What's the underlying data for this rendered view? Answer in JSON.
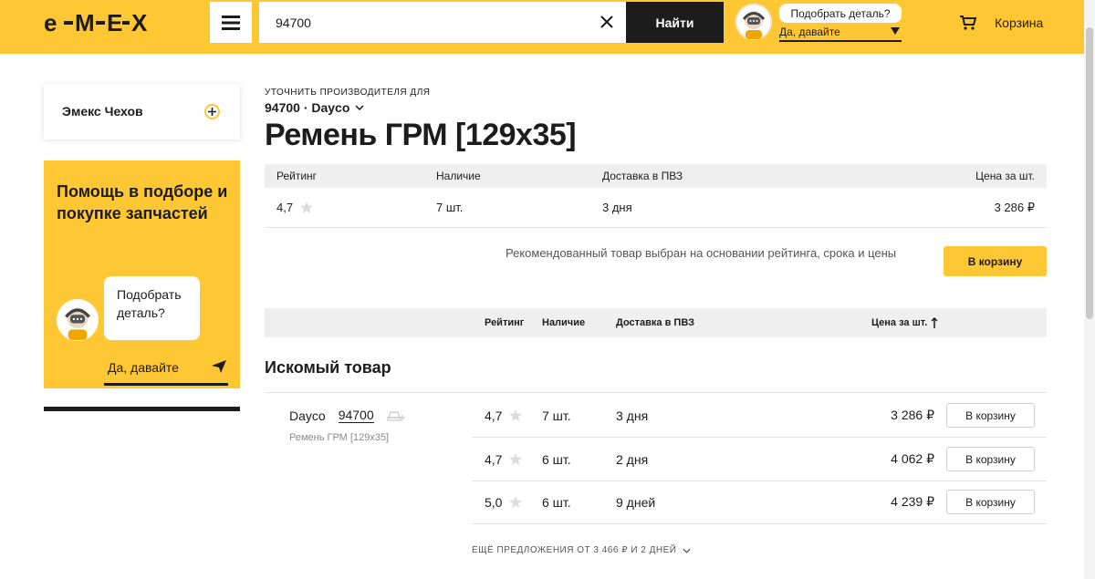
{
  "header": {
    "logo_text": "EMEX",
    "search_value": "94700",
    "search_button": "Найти",
    "bubble_text": "Подобрать деталь?",
    "bubble_link": "Да, давайте",
    "cart_label": "Корзина",
    "colors": {
      "brand_yellow": "#ffc733",
      "dark": "#1c1c1c"
    }
  },
  "sidebar": {
    "store_name": "Эмекс Чехов",
    "help_title": "Помощь в подборе и покупке запчастей",
    "help_bubble": "Подобрать деталь?",
    "help_link": "Да, давайте"
  },
  "main": {
    "refine_label": "УТОЧНИТЬ ПРОИЗВОДИТЕЛЯ ДЛЯ",
    "brand_selector": "94700 · Dayco",
    "title": "Ремень ГРМ [129x35]",
    "top_table": {
      "headers": {
        "rating": "Рейтинг",
        "stock": "Наличие",
        "delivery": "Доставка в ПВЗ",
        "price": "Цена за шт."
      },
      "row": {
        "rating": "4,7",
        "stock": "7 шт.",
        "delivery": "3 дня",
        "price": "3 286 ₽"
      }
    },
    "recommendation_text": "Рекомендованный товар выбран на основании рейтинга, срока и цены",
    "recommendation_button": "В корзину",
    "list_headers": {
      "rating": "Рейтинг",
      "stock": "Наличие",
      "delivery": "Доставка в ПВЗ",
      "price": "Цена за шт."
    },
    "section_title": "Искомый товар",
    "offer": {
      "brand": "Dayco",
      "article": "94700",
      "description": "Ремень ГРМ [129x35]"
    },
    "rows": [
      {
        "rating": "4,7",
        "stock": "7 шт.",
        "delivery": "3 дня",
        "price": "3 286 ₽",
        "button": "В корзину"
      },
      {
        "rating": "4,7",
        "stock": "6 шт.",
        "delivery": "2 дня",
        "price": "4 062 ₽",
        "button": "В корзину"
      },
      {
        "rating": "5,0",
        "stock": "6 шт.",
        "delivery": "9 дней",
        "price": "4 239 ₽",
        "button": "В корзину"
      }
    ],
    "more_offers": "ЕЩЁ ПРЕДЛОЖЕНИЯ ОТ 3 466 ₽ И 2 ДНЕЙ"
  }
}
